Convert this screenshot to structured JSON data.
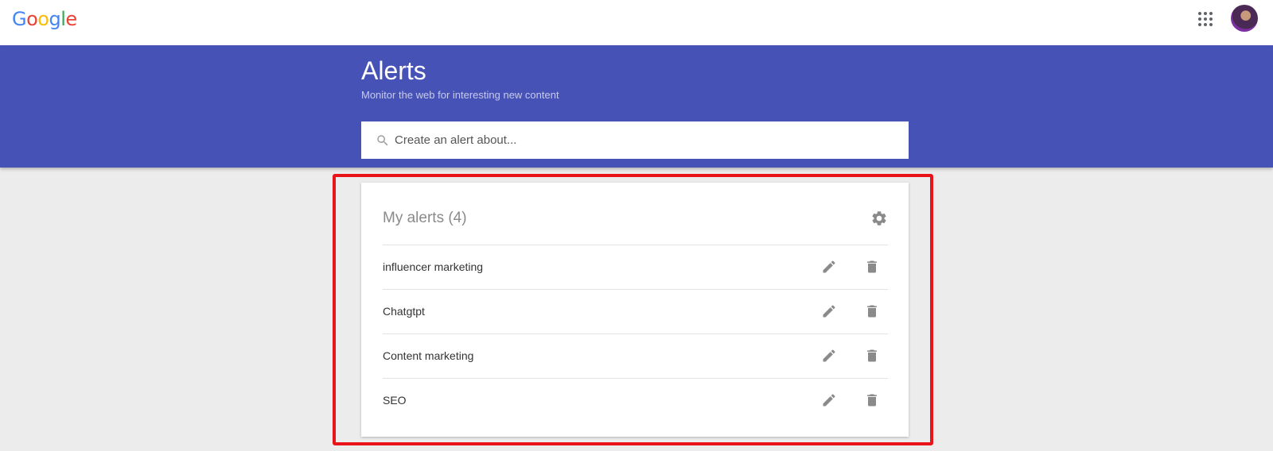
{
  "header": {
    "logo_letters": [
      {
        "char": "G",
        "color": "#4285F4"
      },
      {
        "char": "o",
        "color": "#EA4335"
      },
      {
        "char": "o",
        "color": "#FBBC05"
      },
      {
        "char": "g",
        "color": "#4285F4"
      },
      {
        "char": "l",
        "color": "#34A853"
      },
      {
        "char": "e",
        "color": "#EA4335"
      }
    ],
    "apps_icon": "apps-grid-icon",
    "avatar_icon": "user-avatar"
  },
  "banner": {
    "title": "Alerts",
    "subtitle": "Monitor the web for interesting new content",
    "color": "#4752B6"
  },
  "search": {
    "placeholder": "Create an alert about...",
    "value": "",
    "icon": "search-icon"
  },
  "alerts_card": {
    "title": "My alerts (4)",
    "settings_icon": "gear-icon",
    "items": [
      {
        "name": "influencer marketing"
      },
      {
        "name": "Chatgtpt"
      },
      {
        "name": "Content marketing"
      },
      {
        "name": "SEO"
      }
    ],
    "edit_icon": "pencil-icon",
    "delete_icon": "trash-icon"
  },
  "highlight": {
    "color": "#E8141A"
  }
}
